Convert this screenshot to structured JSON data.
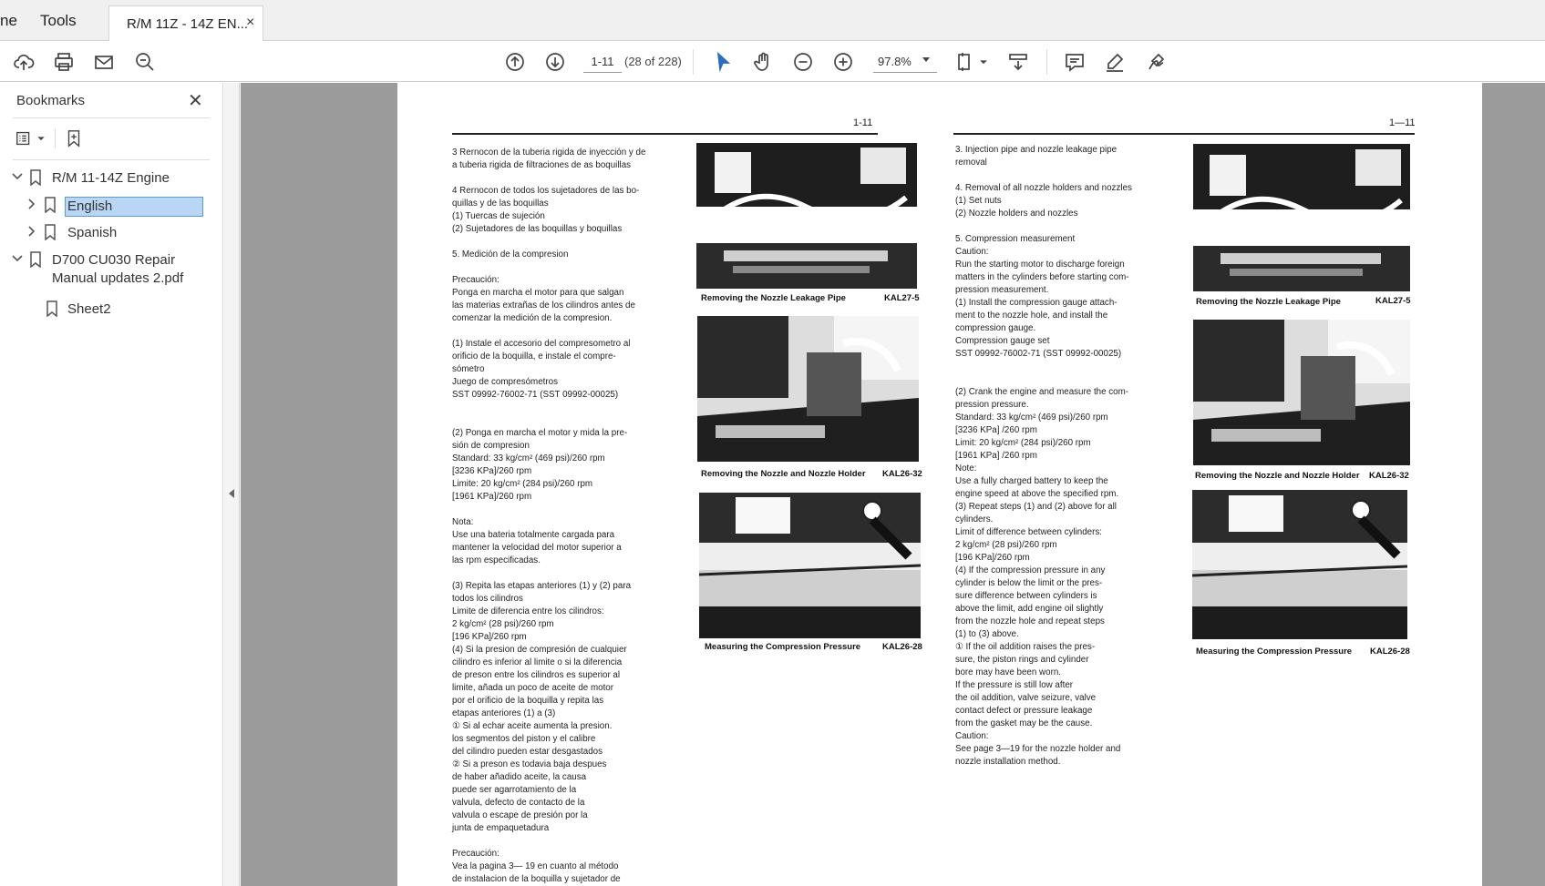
{
  "menu": {
    "home_partial": "ne",
    "tools": "Tools"
  },
  "tab": {
    "title": "R/M 11Z - 14Z EN...",
    "close": "×"
  },
  "toolbar": {
    "page_label": "1-11",
    "page_count": "(28 of 228)",
    "zoom": "97.8%",
    "icons": [
      "upload-icon",
      "print-icon",
      "mail-icon",
      "zoom-search-icon",
      "prev-page-icon",
      "next-page-icon",
      "select-arrow-icon",
      "hand-icon",
      "zoom-out-icon",
      "zoom-in-icon",
      "fit-page-icon",
      "scroll-mode-icon",
      "comment-icon",
      "highlight-icon",
      "sign-icon"
    ]
  },
  "sidebar": {
    "title": "Bookmarks",
    "close": "✕",
    "tree": [
      {
        "label": "R/M 11-14Z Engine",
        "expanded": true
      },
      {
        "label": "English",
        "selected": true
      },
      {
        "label": "Spanish"
      },
      {
        "label": "D700 CU030 Repair",
        "label2": "Manual updates 2.pdf",
        "expanded": true
      },
      {
        "label": "Sheet2"
      }
    ]
  },
  "document": {
    "left_page_num": "1-11",
    "right_page_num": "1—11",
    "spanish_text": "3      Rernocon de la tuberia rigida de inyección y de\n        a tuberia rigida de filtraciones de as boquillas\n\n4      Rernocon de todos los sujetadores de las bo-\n        quillas y de las boquillas\n        (1)  Tuercas de sujeción\n        (2)  Sujetadores de las boquillas y boquillas\n\n5.     Medición de la compresion\n\n        Precaución:\n        Ponga en marcha el motor para que salgan\n        las materias extrañas de los cilindros antes de\n        comenzar la medición de la compresion.\n\n        (1)  Instale el accesorio del compresometro al\n               orificio de la boquilla, e instale el compre-\n               sómetro\n               Juego de compresómetros\n               SST 09992-76002-71 (SST 09992-00025)\n\n\n        (2)  Ponga en marcha el motor y mida la pre-\n               sión de compresion\n               Standard: 33 kg/cm² (469 psi)/260 rpm\n                                          [3236 KPa]/260 rpm\n               Limite: 20 kg/cm² (284 psi)/260 rpm\n                                         [1961 KPa]/260 rpm\n\n        Nota:\n        Use una bateria totalmente cargada para\n        mantener la velocidad del motor superior a\n        las rpm especificadas.\n\n        (3)  Repita las etapas anteriores (1) y (2) para\n               todos los cilindros\n               Limite de diferencia entre los cilindros:\n                    2 kg/cm² (28 psi)/260 rpm\n                              [196 KPa]/260 rpm\n        (4)  Si la presion de compresión de cualquier\n               cilindro es inferior al limite o si la diferencia\n               de preson entre los cilindros es superior al\n               limite, añada un poco de aceite de motor\n               por el orificio de la boquilla y repita las\n               etapas anteriores (1) a (3)\n               ①  Si al echar aceite aumenta la presion.\n                     los segmentos del piston y el calibre\n                     del cilindro pueden estar desgastados\n               ②  Si a preson es todavia baja despues\n                     de haber añadido aceite, la causa\n                     puede ser agarrotamiento de la\n                     valvula, defecto de contacto de la\n                     valvula o escape de presión por la\n                     junta de empaquetadura\n\n        Precaución:\n        Vea la pagina 3— 19 en cuanto al método\n        de instalacion de la boquilla y sujetador de",
    "english_text": "3.    Injection pipe and nozzle leakage pipe\n       removal\n\n4.    Removal of all nozzle holders and nozzles\n       (1)  Set nuts\n       (2)  Nozzle holders and nozzles\n\n5.    Compression measurement\n       Caution:\n       Run the starting motor to discharge foreign\n       matters in the cylinders before starting com-\n       pression measurement.\n       (1)  Install the compression gauge attach-\n              ment to the nozzle hole, and install the\n              compression gauge.\n              Compression gauge set\n              SST 09992-76002-71 (SST 09992-00025)\n\n\n       (2)  Crank the engine and measure the com-\n              pression pressure.\n              Standard: 33 kg/cm² (469 psi)/260 rpm\n                                       [3236 KPa] /260 rpm\n              Limit: 20 kg/cm² (284 psi)/260 rpm\n                                     [1961 KPa] /260 rpm\n       Note:\n       Use a fully charged battery to keep the\n       engine speed at above the specified rpm.\n       (3)  Repeat steps (1) and (2) above for all\n              cylinders.\n              Limit of difference between cylinders:\n                    2 kg/cm² (28 psi)/260 rpm\n                               [196 KPa]/260 rpm\n       (4)  If the compression pressure in any\n              cylinder is below the limit or the pres-\n              sure difference between cylinders is\n              above the limit, add engine oil slightly\n              from the nozzle hole and repeat steps\n              (1) to (3) above.\n              ①  If the oil addition raises the pres-\n                    sure, the piston rings and cylinder\n                    bore may have been worn.\n                    If the pressure is still low after\n                    the oil addition, valve seizure, valve\n                    contact defect or pressure leakage\n                    from the gasket may be the cause.\n       Caution:\n       See page 3—19 for the nozzle holder and\n       nozzle installation method.",
    "left_figures": [
      {
        "caption": "Removing the Nozzle Leakage Pipe",
        "code": "KAL27-5"
      },
      {
        "caption": "Removing the Nozzle and Nozzle Holder",
        "code": "KAL26-32"
      },
      {
        "caption": "Measuring the Compression Pressure",
        "code": "KAL26-28"
      }
    ],
    "right_figures": [
      {
        "caption": "Removing the Nozzle Leakage Pipe",
        "code": "KAL27-5"
      },
      {
        "caption": "Removing the Nozzle and Nozzle Holder",
        "code": "KAL26-32"
      },
      {
        "caption": "Measuring the Compression Pressure",
        "code": "KAL26-28"
      }
    ]
  }
}
